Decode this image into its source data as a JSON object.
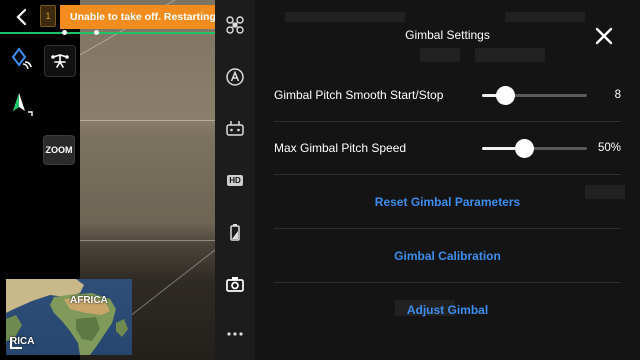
{
  "top": {
    "battery_level": "1",
    "alert_text": "Unable to take off. Restarting aircraft..."
  },
  "left": {
    "zoom_label": "ZOOM"
  },
  "minimap": {
    "label_africa": "AFRICA",
    "label_corner": "RICA"
  },
  "settings": {
    "title": "Gimbal Settings",
    "sliders": [
      {
        "label": "Gimbal Pitch Smooth Start/Stop",
        "value_text": "8",
        "level": 0.22
      },
      {
        "label": "Max Gimbal Pitch Speed",
        "value_text": "50%",
        "level": 0.4
      }
    ],
    "actions": [
      {
        "label": "Reset Gimbal Parameters"
      },
      {
        "label": "Gimbal Calibration"
      },
      {
        "label": "Adjust Gimbal"
      }
    ]
  },
  "colors": {
    "alert": "#f28c1e",
    "link": "#3d8df0",
    "progress": "#1fc46a",
    "panel_bg": "#141414",
    "toolbar_bg": "#1c1c1c"
  },
  "icons": {
    "back": "chevron-left-icon",
    "map_mode": "compass-diamond-icon",
    "track": "drone-track-icon",
    "nav": "navigation-arrow-icon",
    "aircraft": "drone-icon",
    "flight_mode": "a-circle-icon",
    "remote": "remote-controller-icon",
    "video": "hd-icon",
    "battery": "battery-icon",
    "camera": "camera-icon",
    "more": "more-dots-icon",
    "close": "close-icon"
  }
}
